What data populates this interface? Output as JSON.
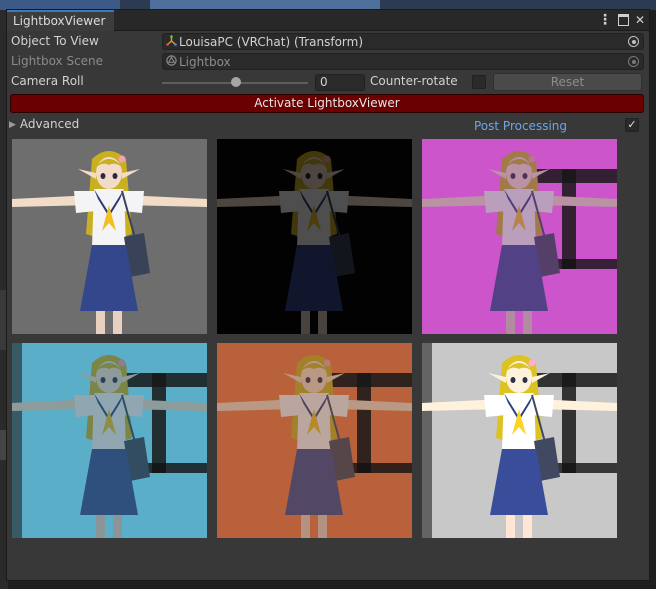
{
  "window": {
    "tab_title": "LightboxViewer",
    "controls": {
      "menu": "⋮",
      "close": "✕"
    }
  },
  "fields": {
    "object_to_view": {
      "label": "Object To View",
      "value": "LouisaPC (VRChat) (Transform)",
      "icon": "transform-icon"
    },
    "lightbox_scene": {
      "label": "Lightbox Scene",
      "value": "Lightbox",
      "icon": "unity-scene-icon"
    },
    "camera_roll": {
      "label": "Camera Roll",
      "value": "0",
      "slider_fraction": 0.5
    }
  },
  "counter_rotate": {
    "label": "Counter-rotate",
    "checked": false
  },
  "reset_button": "Reset",
  "activate_button": "Activate LightboxViewer",
  "advanced": {
    "label": "Advanced",
    "expanded": false
  },
  "post_processing": {
    "label": "Post Processing",
    "checked": true,
    "check_glyph": "✓"
  },
  "previews": [
    {
      "name": "preview-grey",
      "bg": "#6e6e6e",
      "light": 1.0,
      "tint": "none"
    },
    {
      "name": "preview-dark",
      "bg": "#020202",
      "light": 0.32,
      "tint": "none"
    },
    {
      "name": "preview-magenta",
      "bg": "#cc55cc",
      "light": 0.75,
      "tint": "#c060c8"
    },
    {
      "name": "preview-cyan",
      "bg": "#5aaec8",
      "light": 0.7,
      "tint": "#4a9ec0"
    },
    {
      "name": "preview-orange",
      "bg": "#b8613a",
      "light": 0.75,
      "tint": "#c07a5a"
    },
    {
      "name": "preview-white",
      "bg": "#c8c8c8",
      "light": 1.1,
      "tint": "none"
    }
  ]
}
